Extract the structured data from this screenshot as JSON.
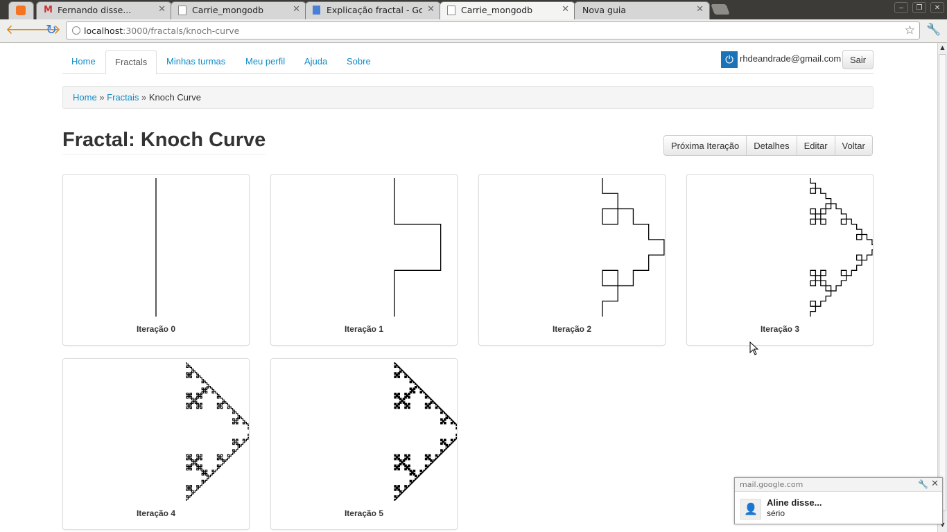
{
  "browser": {
    "tabs": [
      {
        "title": "",
        "icon": "ubuntu-one-icon"
      },
      {
        "title": "Fernando disse...",
        "icon": "gmail-icon"
      },
      {
        "title": "Carrie_mongodb",
        "icon": "page-icon"
      },
      {
        "title": "Explicação fractal - Google",
        "icon": "google-docs-icon"
      },
      {
        "title": "Carrie_mongodb",
        "icon": "page-icon",
        "active": true
      },
      {
        "title": "Nova guia",
        "icon": "none"
      }
    ],
    "url_host": "localhost",
    "url_path": ":3000/fractals/knoch-curve"
  },
  "nav": {
    "items": [
      "Home",
      "Fractals",
      "Minhas turmas",
      "Meu perfil",
      "Ajuda",
      "Sobre"
    ],
    "active": "Fractals",
    "user_email": "rhdeandrade@gmail.com",
    "logout_label": "Sair"
  },
  "breadcrumb": {
    "home": "Home",
    "fractais": "Fractais",
    "current": "Knoch Curve",
    "separator": "»"
  },
  "page": {
    "title": "Fractal: Knoch Curve",
    "actions": [
      "Próxima Iteração",
      "Detalhes",
      "Editar",
      "Voltar"
    ]
  },
  "iterations": [
    {
      "label": "Iteração 0",
      "level": 0
    },
    {
      "label": "Iteração 1",
      "level": 1
    },
    {
      "label": "Iteração 2",
      "level": 2
    },
    {
      "label": "Iteração 3",
      "level": 3
    },
    {
      "label": "Iteração 4",
      "level": 4
    },
    {
      "label": "Iteração 5",
      "level": 5
    }
  ],
  "notification": {
    "source": "mail.google.com",
    "title": "Aline disse...",
    "body": "sério"
  }
}
